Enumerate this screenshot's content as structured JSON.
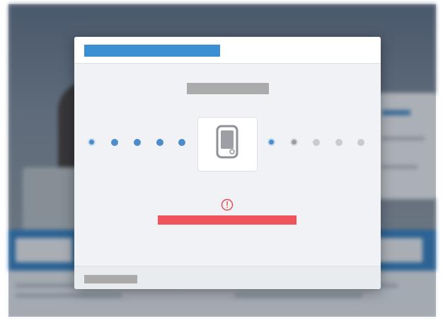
{
  "background": {
    "description_visible": false
  },
  "modal": {
    "title": "",
    "subtitle": "",
    "status_icon": "warning-circle-icon",
    "device_icon": "tablet-device-icon",
    "error_message": "",
    "footer_text": "",
    "progress": {
      "steps_before": 5,
      "steps_after": 5,
      "current_step_after": 1
    }
  },
  "colors": {
    "accent": "#3b8fd3",
    "dot_active": "#4d8ccb",
    "dot_inactive": "#c9cbce",
    "error": "#f0545a",
    "warning_icon": "#e8474c"
  }
}
